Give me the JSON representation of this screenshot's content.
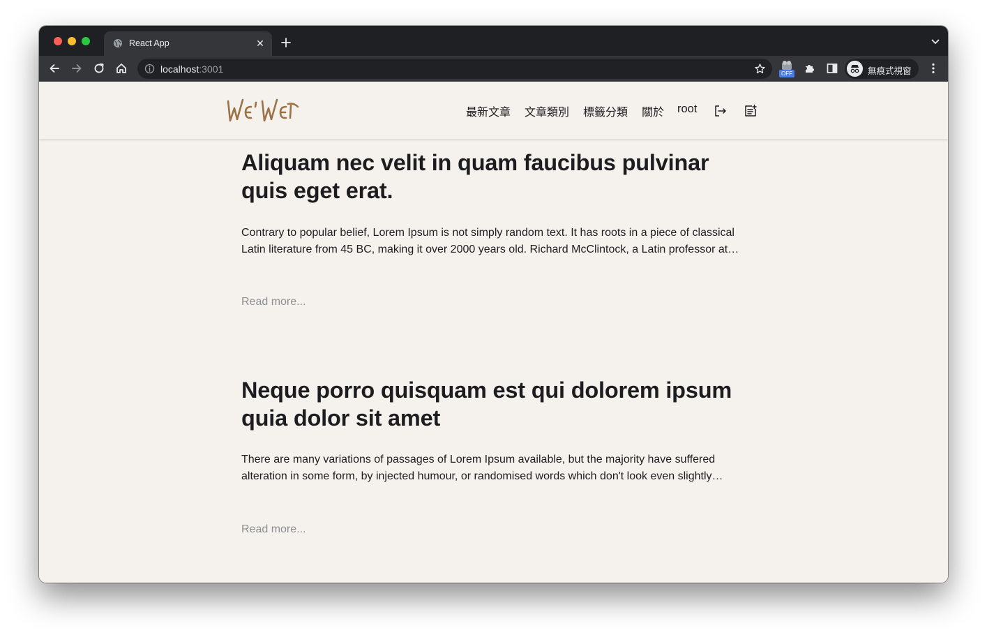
{
  "browser": {
    "tab_title": "React App",
    "url_host": "localhost",
    "url_port": ":3001",
    "extension_badge": "OFF",
    "profile_label": "無痕式視窗"
  },
  "site": {
    "logo_text": "WEIWEI",
    "nav": {
      "latest": "最新文章",
      "categories": "文章類別",
      "tags": "標籤分類",
      "about": "關於",
      "user": "root"
    }
  },
  "posts": [
    {
      "title": "Aliquam nec velit in quam faucibus pulvinar quis eget erat.",
      "excerpt": "Contrary to popular belief, Lorem Ipsum is not simply random text. It has roots in a piece of classical Latin literature from 45 BC, making it over 2000 years old. Richard McClintock, a Latin professor at Hampden-Sydney College in Virginia, looked up one of the more obscure Latin words.",
      "read_more": "Read more..."
    },
    {
      "title": "Neque porro quisquam est qui dolorem ipsum quia dolor sit amet",
      "excerpt": "There are many variations of passages of Lorem Ipsum available, but the majority have suffered alteration in some form, by injected humour, or randomised words which don't look even slightly believable.",
      "read_more": "Read more..."
    }
  ],
  "colors": {
    "page_bg": "#f5f2ee",
    "logo": "#9b7246",
    "text": "#1d1d1f",
    "muted": "#8d8f93"
  }
}
